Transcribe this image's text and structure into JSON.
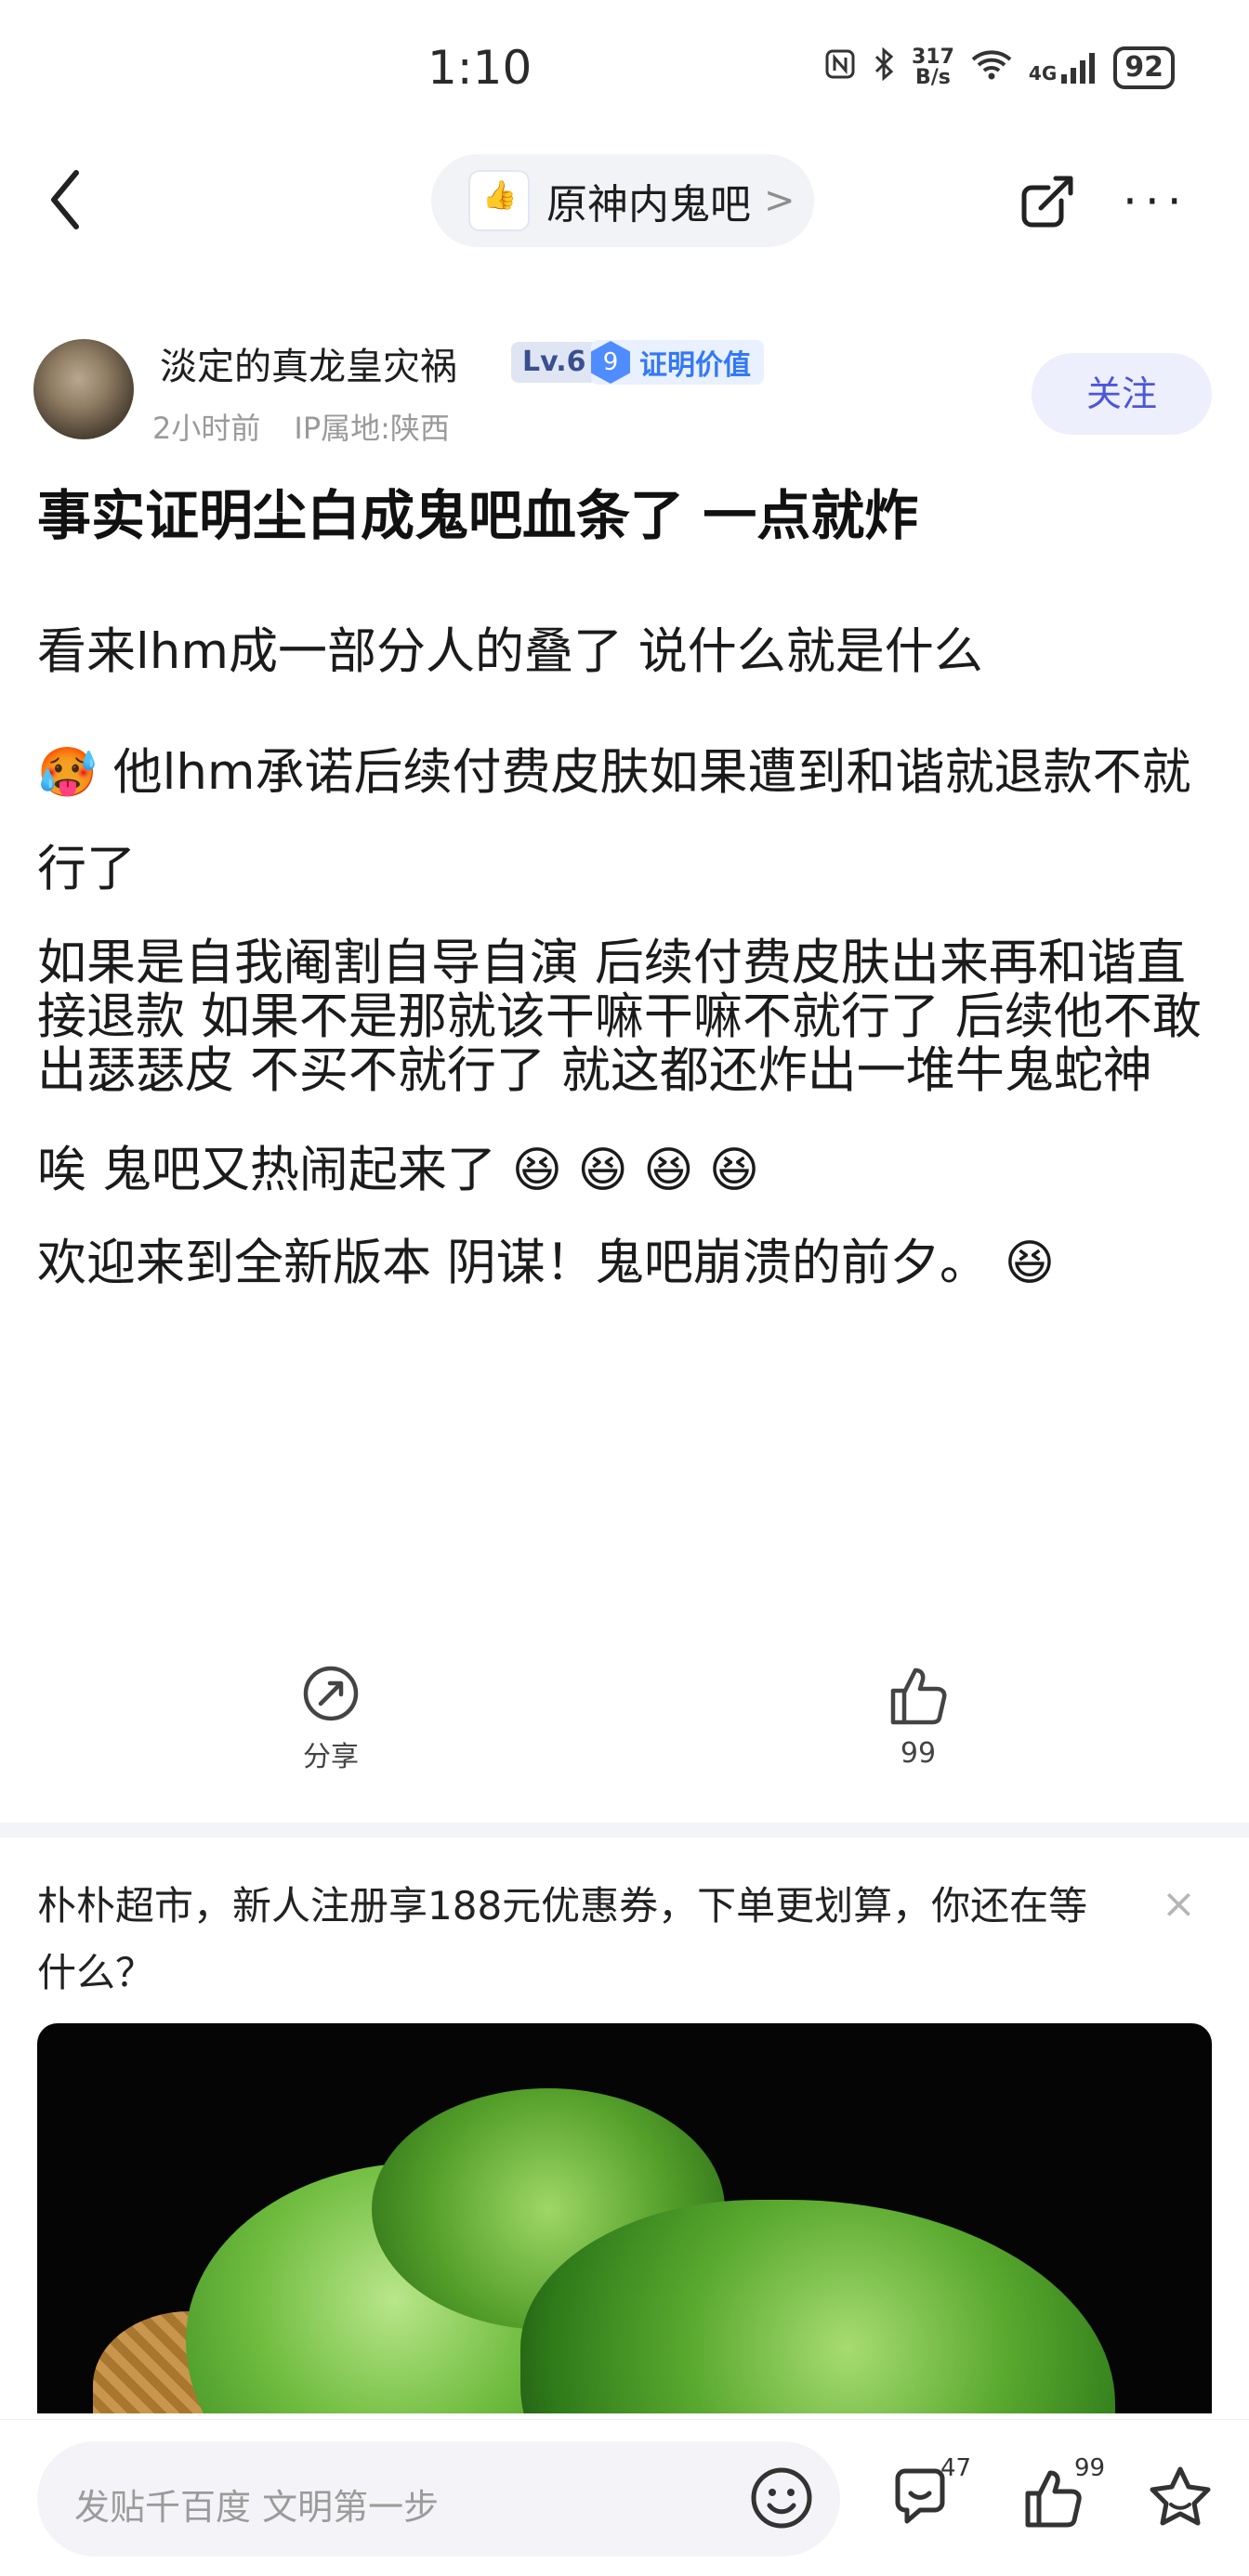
{
  "status_bar": {
    "time": "1:10",
    "net_speed_top": "317",
    "net_speed_bottom": "B/s",
    "network": "4G",
    "battery": "92",
    "icons": [
      "nfc-icon",
      "bluetooth-icon",
      "wifi-icon",
      "signal-icon",
      "battery-icon"
    ]
  },
  "nav": {
    "forum_name": "原神内鬼吧",
    "forum_chevron": ">",
    "more_label": "···"
  },
  "author": {
    "name": "淡定的真龙皇灾祸",
    "level": "Lv.6",
    "badge_num": "9",
    "badge_text": "证明价值",
    "time": "2小时前",
    "ip": "IP属地:陕西",
    "follow_label": "关注"
  },
  "post": {
    "title": "事实证明尘白成鬼吧血条了  一点就炸",
    "paragraphs": {
      "p1": "看来lhm成一部分人的叠了 说什么就是什么",
      "p2_emoji": "🥵",
      "p2": " 他lhm承诺后续付费皮肤如果遭到和谐就退款不就行了",
      "p3": "如果是自我阉割自导自演 后续付费皮肤出来再和谐直接退款 如果不是那就该干嘛干嘛不就行了 后续他不敢出瑟瑟皮 不买不就行了 就这都还炸出一堆牛鬼蛇神",
      "p4": "唉 鬼吧又热闹起来了",
      "p4_emojis": "😆  😆  😆  😆",
      "p5": "欢迎来到全新版本 阴谋！鬼吧崩溃的前夕。",
      "p5_emoji": "😆"
    }
  },
  "actions": {
    "share_label": "分享",
    "like_count": "99"
  },
  "ad": {
    "text": "朴朴超市，新人注册享188元优惠券，下单更划算，你还在等什么？",
    "close": "×"
  },
  "bottom_bar": {
    "placeholder": "发贴千百度 文明第一步",
    "comment_count": "47",
    "like_count": "99"
  }
}
